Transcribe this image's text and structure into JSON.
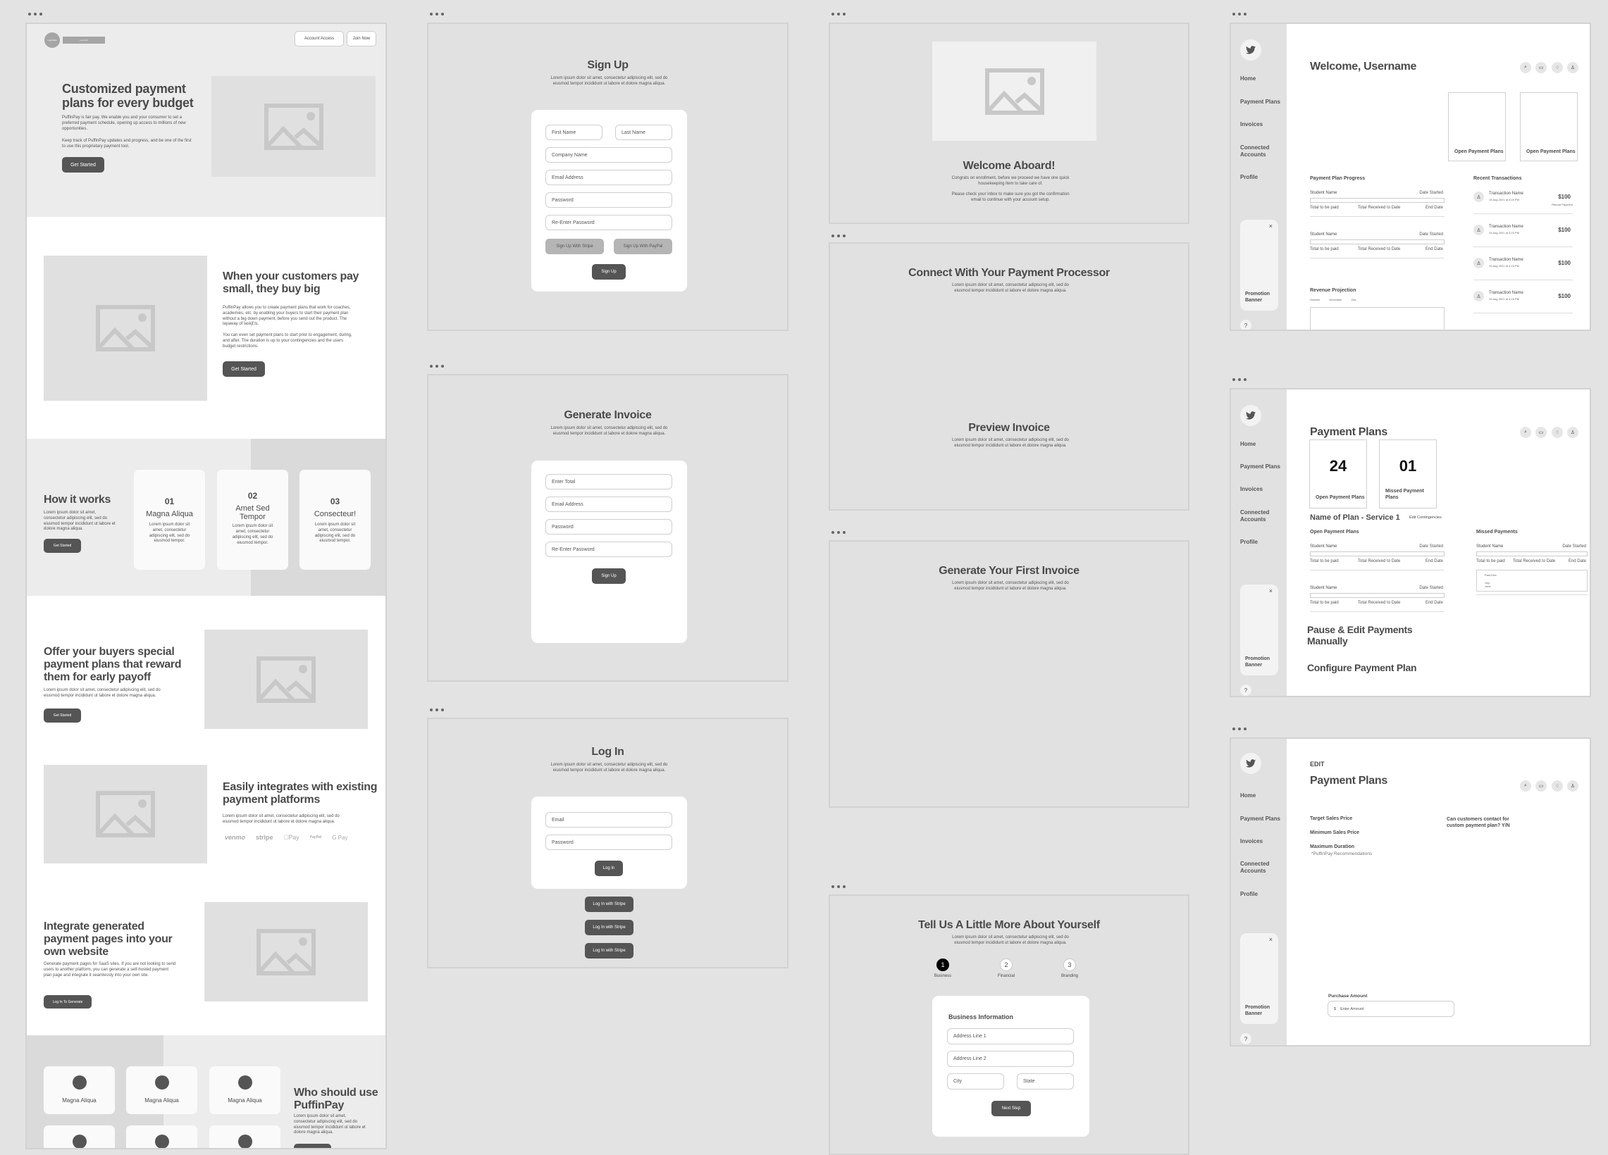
{
  "colors": {
    "canvas": "#e3e3e3",
    "frame": "#e1e1e1",
    "button_dark": "#555555",
    "button_light": "#b5b5b5",
    "active_step": "#000000"
  },
  "landing": {
    "logo_mark": "LogoMark",
    "logo_text": "LogoText",
    "nav": {
      "account": "Account Access",
      "join": "Join Now"
    },
    "hero": {
      "title": "Customized payment plans for every budget",
      "p1": "PuffinPay is fair pay. We enable you and your consumer to set a preferred payment schedule, opening up access to millions of new opportunities.",
      "p2": "Keep track of PuffinPay updates and progress, and be one of the first to use this proprietary payment tool.",
      "cta": "Get Started"
    },
    "section2": {
      "title": "When your customers pay small, they buy big",
      "p1": "PuffinPay allows you to create payment plans that work for coaches, academies, etc. by enabling your buyers to start their payment plan without a big down payment, before you send out the product. The layaway of laskjf;ls.",
      "p2": "You can even set payment plans to start prior to engagement, during, and after. The duration is up to your contingencies and the users budget restrictions.",
      "cta": "Get Started"
    },
    "how": {
      "title": "How it works",
      "body": "Lorem ipsum dolor sit amet, consectetur adipiscing elit, sed do eiusmod tempor incididunt ut labore et dolore magna aliqua.",
      "cta": "Get Started",
      "steps": [
        {
          "num": "01",
          "title": "Magna Aliqua",
          "body": "Lorem ipsum dolor sit amet, consectetur adipiscing elit, sed do eiusmod tempor."
        },
        {
          "num": "02",
          "title": "Amet Sed Tempor",
          "body": "Lorem ipsum dolor sit amet, consectetur adipiscing elit, sed do eiusmod tempor."
        },
        {
          "num": "03",
          "title": "Consecteur!",
          "body": "Lorem ipsum dolor sit amet, consectetur adipiscing elit, sed do eiusmod tempor."
        }
      ]
    },
    "offer": {
      "title": "Offer your buyers special payment plans that reward them for early payoff",
      "body": "Lorem ipsum dolor sit amet, consectetur adipiscing elit, sed do eiusmod tempor incididunt ut labore et dolore magna aliqua.",
      "cta": "Get Started"
    },
    "integrates": {
      "title": "Easily integrates with existing payment platforms",
      "body": "Lorem ipsum dolor sit amet, consectetur adipiscing elit, sed do eiusmod tempor incididunt ut labore et dolore magna aliqua.",
      "logos": [
        "venmo",
        "stripe",
        "Pay",
        "PayPal",
        "G Pay"
      ]
    },
    "embed": {
      "title": "Integrate generated payment pages into your own website",
      "body": "Generate payment pages for SaaS sites. If you are not looking to send users to another platform, you can generate a self-hosted payment plan page and integrate it seamlessly into your own site.",
      "cta": "Log In To Generate"
    },
    "who": {
      "title": "Who should use PuffinPay",
      "body": "Lorem ipsum dolor sit amet, consectetur adipiscing elit, sed do eiusmod tempor incididunt ut labore et dolore magna aliqua.",
      "cards": [
        "Magna Aliqua",
        "Magna Aliqua",
        "Magna Aliqua"
      ]
    }
  },
  "signup": {
    "title": "Sign Up",
    "body": "Lorem ipsum dolor sit amet, consectetur adipiscing elit, sed do eiusmod tempor incididunt ut labore et dolore magna aliqua.",
    "first": "First Name",
    "last": "Last Name",
    "company": "Company Name",
    "email": "Email Address",
    "password": "Password",
    "repassword": "Re-Enter Password",
    "stripe": "Sign Up With Stripe",
    "paypal": "Sign Up With PayPal",
    "submit": "Sign Up"
  },
  "invoice": {
    "title": "Generate Invoice",
    "body": "Lorem ipsum dolor sit amet, consectetur adipiscing elit, sed do eiusmod tempor incididunt ut labore et dolore magna aliqua.",
    "total": "Enter Total",
    "email": "Email Address",
    "password": "Password",
    "repassword": "Re-Enter Password",
    "submit": "Sign Up"
  },
  "login": {
    "title": "Log In",
    "body": "Lorem ipsum dolor sit amet, consectetur adipiscing elit, sed do eiusmod tempor incididunt ut labore et dolore magna aliqua.",
    "email": "Email",
    "password": "Password",
    "submit": "Log In",
    "alt": [
      "Log In with Stripe",
      "Log In with Stripe",
      "Log In with Stripe"
    ]
  },
  "welcome": {
    "title": "Welcome Aboard!",
    "p1": "Congrats on enrollment, before we proceed we have one quick housekeeping item to take care of.",
    "p2": "Please check your inbox to make sure you got the confirmation email to continue with your account setup."
  },
  "connect": {
    "title": "Connect With Your Payment Processor",
    "body": "Lorem ipsum dolor sit amet, consectetur adipiscing elit, sed do eiusmod tempor incididunt ut labore et dolore magna aliqua.",
    "preview_title": "Preview Invoice",
    "preview_body": "Lorem ipsum dolor sit amet, consectetur adipiscing elit, sed do eiusmod tempor incididunt ut labore et dolore magna aliqua."
  },
  "first_invoice": {
    "title": "Generate Your First Invoice",
    "body": "Lorem ipsum dolor sit amet, consectetur adipiscing elit, sed do eiusmod tempor incididunt ut labore et dolore magna aliqua."
  },
  "onboard": {
    "title": "Tell Us A Little More About Yourself",
    "body": "Lorem ipsum dolor sit amet, consectetur adipiscing elit, sed do eiusmod tempor incididunt ut labore et dolore magna aliqua.",
    "active_step": 1,
    "steps": [
      {
        "n": "1",
        "label": "Business"
      },
      {
        "n": "2",
        "label": "Financial"
      },
      {
        "n": "3",
        "label": "Branding"
      }
    ],
    "form_title": "Business Information",
    "addr1": "Address Line 1",
    "addr2": "Address Line 2",
    "city": "City",
    "state": "State",
    "next": "Next Step"
  },
  "dashboard": {
    "nav": [
      "Home",
      "Payment Plans",
      "Invoices",
      "Connected Accounts",
      "Profile"
    ],
    "promo": "Promotion Banner",
    "close": "×",
    "help": "?",
    "home": {
      "title": "Welcome, Username",
      "cards": [
        "Open Payment Plans",
        "Open Payment Plans"
      ],
      "progress_title": "Payment Plan Progress",
      "row": {
        "name": "Student Name",
        "started": "Date Started",
        "total": "Total to be paid",
        "received": "Total Received to Date",
        "end": "End Date"
      },
      "transactions_title": "Recent Transactions",
      "tx": {
        "name": "Transaction Name",
        "date": "15 Aug 2021 at 4:15 PM",
        "amount": "$100",
        "refund": "Refund Payment"
      },
      "revenue_title": "Revenue Projection",
      "months": [
        "October",
        "November",
        "Dec"
      ]
    },
    "plans": {
      "title": "Payment Plans",
      "stats": [
        {
          "value": "24",
          "label": "Open Payment Plans"
        },
        {
          "value": "01",
          "label": "Missed Payment Plans"
        }
      ],
      "plan_name": "Name of Plan - Service 1",
      "edit": "Edit Contingencies",
      "open_title": "Open Payment Plans",
      "missed_title": "Missed Payments",
      "past_due": "Past Due:",
      "past_months": [
        "July",
        "June"
      ],
      "pause": "Pause & Edit Payments Manually",
      "configure": "Configure Payment Plan"
    },
    "edit": {
      "eyebrow": "EDIT",
      "title": "Payment Plans",
      "fields": [
        "Target Sales Price",
        "Minimum Sales Price",
        "Maximum Duration"
      ],
      "note": "*PuffinPay Recommendations",
      "question": "Can customers contact for custom payment plan? Y/N",
      "purchase_label": "Purchase Amount",
      "currency": "$",
      "placeholder": "Enter Amount"
    }
  }
}
